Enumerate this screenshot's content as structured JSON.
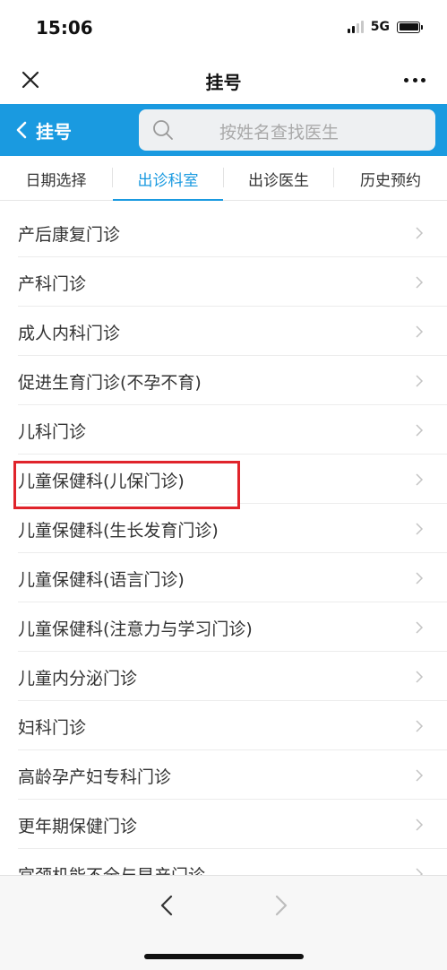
{
  "status_bar": {
    "time": "15:06",
    "network": "5G"
  },
  "navbar": {
    "title": "挂号"
  },
  "header": {
    "back_label": "挂号",
    "search_placeholder": "按姓名查找医生"
  },
  "tabs": [
    {
      "label": "日期选择",
      "active": false
    },
    {
      "label": "出诊科室",
      "active": true
    },
    {
      "label": "出诊医生",
      "active": false
    },
    {
      "label": "历史预约",
      "active": false
    }
  ],
  "departments": [
    "产后康复门诊",
    "产科门诊",
    "成人内科门诊",
    "促进生育门诊(不孕不育)",
    "儿科门诊",
    "儿童保健科(儿保门诊)",
    "儿童保健科(生长发育门诊)",
    "儿童保健科(语言门诊)",
    "儿童保健科(注意力与学习门诊)",
    "儿童内分泌门诊",
    "妇科门诊",
    "高龄孕产妇专科门诊",
    "更年期保健门诊",
    "宫颈机能不全与早产门诊"
  ],
  "highlighted_item": "儿童保健科(儿保门诊)",
  "colors": {
    "accent": "#1a9ae0",
    "highlight_border": "#e0242b"
  }
}
